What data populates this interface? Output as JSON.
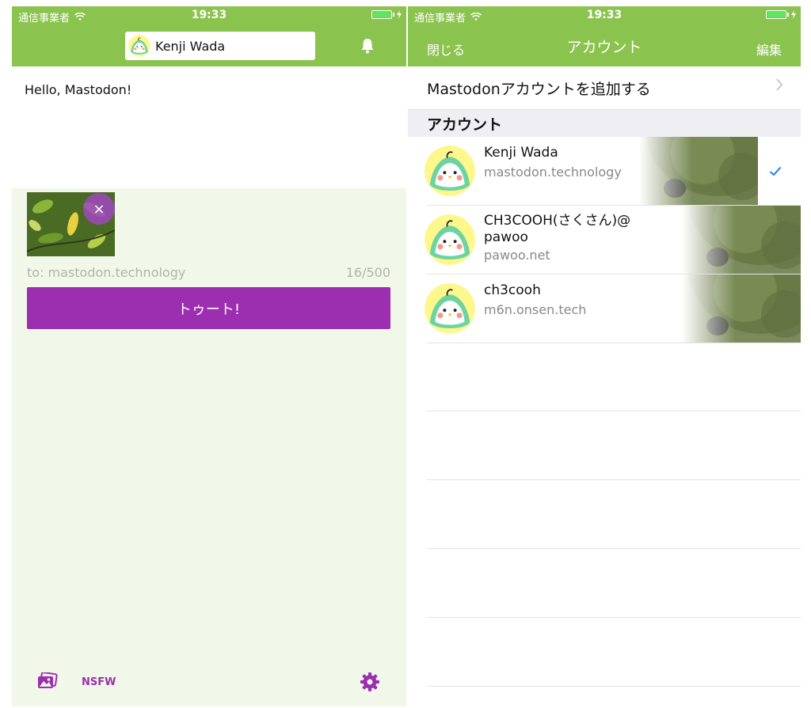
{
  "status": {
    "carrier": "通信事業者",
    "time": "19:33"
  },
  "compose_screen": {
    "account_name": "Kenji Wada",
    "text": "Hello, Mastodon!",
    "visibility_target": "to: mastodon.technology",
    "char_count": "16/500",
    "remove_glyph": "×",
    "toot_label": "トゥート!",
    "nsfw_label": "NSFW"
  },
  "accounts_screen": {
    "close_label": "閉じる",
    "title": "アカウント",
    "edit_label": "編集",
    "add_account_label": "Mastodonアカウントを追加する",
    "section_header": "アカウント",
    "accounts": [
      {
        "name": "Kenji Wada",
        "host": "mastodon.technology",
        "selected": true
      },
      {
        "name": "CH3COOH(さくさん)@\npawoo",
        "host": "pawoo.net",
        "selected": false
      },
      {
        "name": "ch3cooh",
        "host": "m6n.onsen.tech",
        "selected": false
      }
    ]
  },
  "colors": {
    "bar": "#8bc34f",
    "accent": "#9c2eb0",
    "check": "#1e7cf2",
    "compose_bg": "#f1f7e9"
  }
}
